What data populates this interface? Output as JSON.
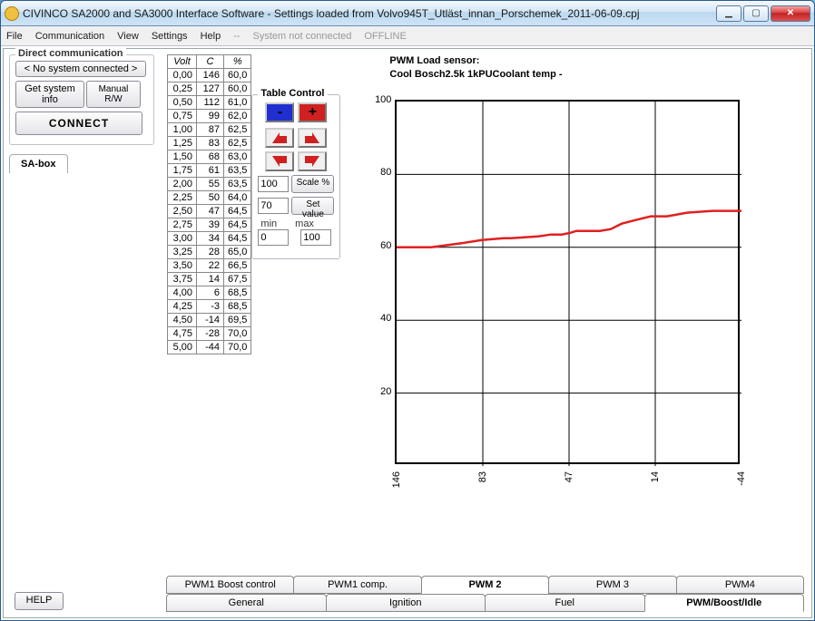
{
  "window": {
    "title": "CIVINCO SA2000 and SA3000 Interface Software - Settings loaded from Volvo945T_Utläst_innan_Porschemek_2011-06-09.cpj"
  },
  "menu": {
    "file": "File",
    "comm": "Communication",
    "view": "View",
    "settings": "Settings",
    "help": "Help",
    "sep": "--",
    "status1": "System not connected",
    "status2": "OFFLINE"
  },
  "direct": {
    "legend": "Direct communication",
    "no_system": "< No system connected >",
    "get_info": "Get system info",
    "manual": "Manual R/W",
    "connect": "CONNECT"
  },
  "sabox": "SA-box",
  "help_btn": "HELP",
  "table": {
    "h1": "Volt",
    "h2": "C",
    "h3": "%",
    "rows": [
      [
        "0,00",
        "146",
        "60,0"
      ],
      [
        "0,25",
        "127",
        "60,0"
      ],
      [
        "0,50",
        "112",
        "61,0"
      ],
      [
        "0,75",
        "99",
        "62,0"
      ],
      [
        "1,00",
        "87",
        "62,5"
      ],
      [
        "1,25",
        "83",
        "62,5"
      ],
      [
        "1,50",
        "68",
        "63,0"
      ],
      [
        "1,75",
        "61",
        "63,5"
      ],
      [
        "2,00",
        "55",
        "63,5"
      ],
      [
        "2,25",
        "50",
        "64,0"
      ],
      [
        "2,50",
        "47",
        "64,5"
      ],
      [
        "2,75",
        "39",
        "64,5"
      ],
      [
        "3,00",
        "34",
        "64,5"
      ],
      [
        "3,25",
        "28",
        "65,0"
      ],
      [
        "3,50",
        "22",
        "66,5"
      ],
      [
        "3,75",
        "14",
        "67,5"
      ],
      [
        "4,00",
        "6",
        "68,5"
      ],
      [
        "4,25",
        "-3",
        "68,5"
      ],
      [
        "4,50",
        "-14",
        "69,5"
      ],
      [
        "4,75",
        "-28",
        "70,0"
      ],
      [
        "5,00",
        "-44",
        "70,0"
      ]
    ]
  },
  "tc": {
    "legend": "Table Control",
    "minus": "-",
    "plus": "+",
    "scale_val": "100",
    "scale_btn": "Scale %",
    "set_val": "70",
    "set_btn": "Set value",
    "min_lbl": "min",
    "max_lbl": "max",
    "min_val": "0",
    "max_val": "100"
  },
  "chart": {
    "title1": "PWM Load sensor:",
    "title2": "Cool Bosch2.5k 1kPUCoolant temp -",
    "yticks": [
      "100",
      "80",
      "60",
      "40",
      "20"
    ],
    "xticks": [
      "146",
      "83",
      "47",
      "14",
      "-44"
    ]
  },
  "chart_data": {
    "type": "line",
    "title": "PWM Load sensor: Cool Bosch2.5k 1kPUCoolant temp -",
    "xlabel": "C",
    "ylabel": "%",
    "ylim": [
      0,
      100
    ],
    "x": [
      146,
      127,
      112,
      99,
      87,
      83,
      68,
      61,
      55,
      50,
      47,
      39,
      34,
      28,
      22,
      14,
      6,
      -3,
      -14,
      -28,
      -44
    ],
    "y": [
      60.0,
      60.0,
      61.0,
      62.0,
      62.5,
      62.5,
      63.0,
      63.5,
      63.5,
      64.0,
      64.5,
      64.5,
      64.5,
      65.0,
      66.5,
      67.5,
      68.5,
      68.5,
      69.5,
      70.0,
      70.0
    ]
  },
  "tabs": {
    "row1": [
      "PWM1 Boost control",
      "PWM1 comp.",
      "PWM 2",
      "PWM 3",
      "PWM4"
    ],
    "row2": [
      "General",
      "Ignition",
      "Fuel",
      "PWM/Boost/Idle"
    ],
    "active1": 2,
    "active2": 3
  }
}
